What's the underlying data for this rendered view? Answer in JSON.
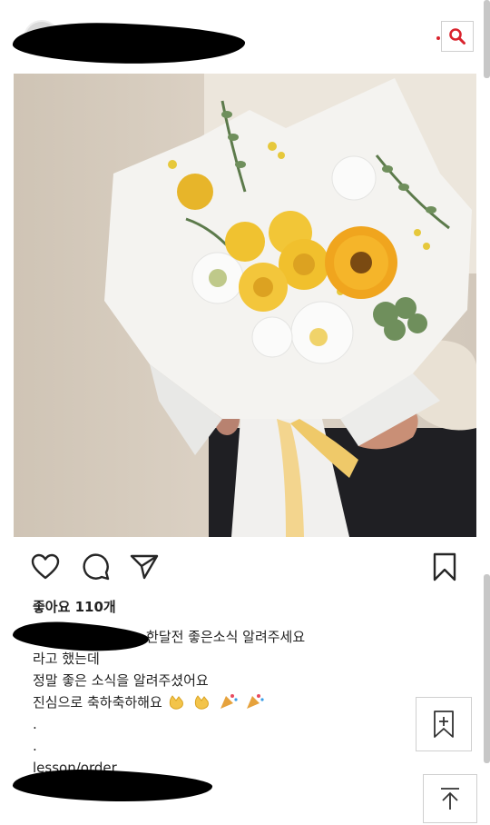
{
  "header": {
    "search_icon": "search-icon",
    "accent_color": "#d9232d"
  },
  "post": {
    "likes_text": "좋아요 110개",
    "caption": {
      "line1_suffix": "c 한달전 좋은소식 알려주세요",
      "line2": "라고 했는데",
      "line3": "정말 좋은 소식을 알려주셨어요",
      "line4": "진심으로 축하축하해요",
      "line5": ".",
      "line6": ".",
      "line7": "lesson/order"
    }
  },
  "floating": {
    "bookmark_add_icon": "bookmark-add-icon",
    "scroll_top_icon": "arrow-up-to-top-icon"
  }
}
